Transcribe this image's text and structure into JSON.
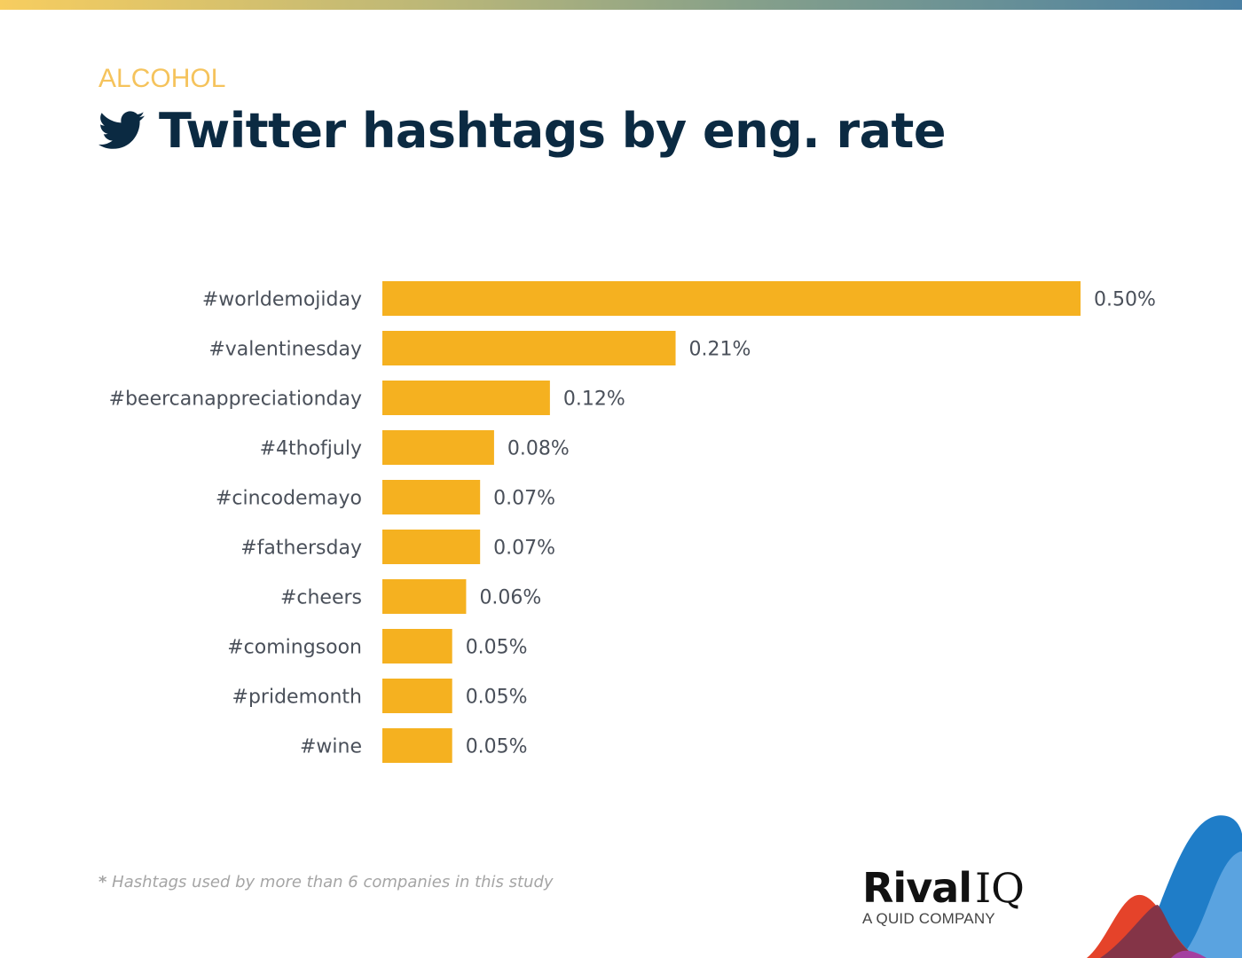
{
  "header": {
    "category": "ALCOHOL",
    "title": "Twitter hashtags by eng. rate",
    "icon": "twitter-bird-icon"
  },
  "colors": {
    "bar": "#f5b120",
    "title": "#0b2a42",
    "category": "#f5c35c",
    "label": "#4a505a"
  },
  "chart_data": {
    "type": "bar",
    "orientation": "horizontal",
    "title": "Twitter hashtags by eng. rate",
    "xlabel": "",
    "ylabel": "",
    "grid": false,
    "xlim": [
      0,
      0.5
    ],
    "categories": [
      "#worldemojiday",
      "#valentinesday",
      "#beercanappreciationday",
      "#4thofjuly",
      "#cincodemayo",
      "#fathersday",
      "#cheers",
      "#comingsoon",
      "#pridemonth",
      "#wine"
    ],
    "values": [
      0.5,
      0.21,
      0.12,
      0.08,
      0.07,
      0.07,
      0.06,
      0.05,
      0.05,
      0.05
    ],
    "value_labels": [
      "0.50%",
      "0.21%",
      "0.12%",
      "0.08%",
      "0.07%",
      "0.07%",
      "0.06%",
      "0.05%",
      "0.05%",
      "0.05%"
    ],
    "unit": "%"
  },
  "footnote": {
    "asterisk": "*",
    "text": "Hashtags used by more than 6 companies in this study"
  },
  "logo": {
    "brand_bold": "Rival",
    "brand_light": "IQ",
    "tagline": "A QUID COMPANY"
  }
}
